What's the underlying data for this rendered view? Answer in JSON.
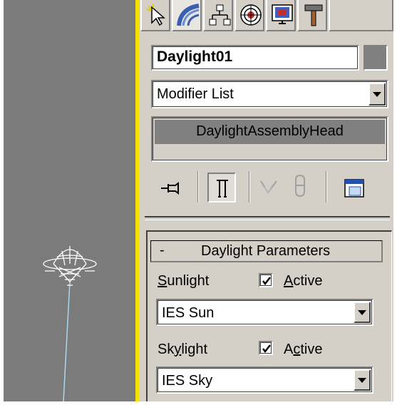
{
  "command_panel": {
    "tabs": [
      {
        "name": "create",
        "icon": "create-cursor-icon"
      },
      {
        "name": "modify",
        "icon": "modify-curve-icon"
      },
      {
        "name": "hierarchy",
        "icon": "hierarchy-icon"
      },
      {
        "name": "motion",
        "icon": "motion-icon"
      },
      {
        "name": "display",
        "icon": "display-icon"
      },
      {
        "name": "utilities",
        "icon": "hammer-icon"
      }
    ],
    "active_tab": "modify",
    "object_name": "Daylight01",
    "object_color": "#808080",
    "modifier_list": "Modifier List",
    "stack_item": "DaylightAssemblyHead"
  },
  "stack_tools": {
    "icons": [
      "pin-stack-icon",
      "show-end-result-icon",
      "make-unique-icon",
      "remove-modifier-icon",
      "configure-sets-icon"
    ]
  },
  "rollout": {
    "toggle": "-",
    "title": "Daylight Parameters",
    "sunlight_label": "Sunlight",
    "sunlight_active_label": "Active",
    "sunlight_active": true,
    "sunlight_value": "IES Sun",
    "skylight_label": "Skylight",
    "skylight_active_label": "Active",
    "skylight_active": true,
    "skylight_value": "IES Sky"
  },
  "colors": {
    "viewport_bg": "#7b7b7b",
    "selection_border": "#f5e000",
    "panel_bg": "#d4d0c8",
    "stack_selected": "#808080"
  }
}
